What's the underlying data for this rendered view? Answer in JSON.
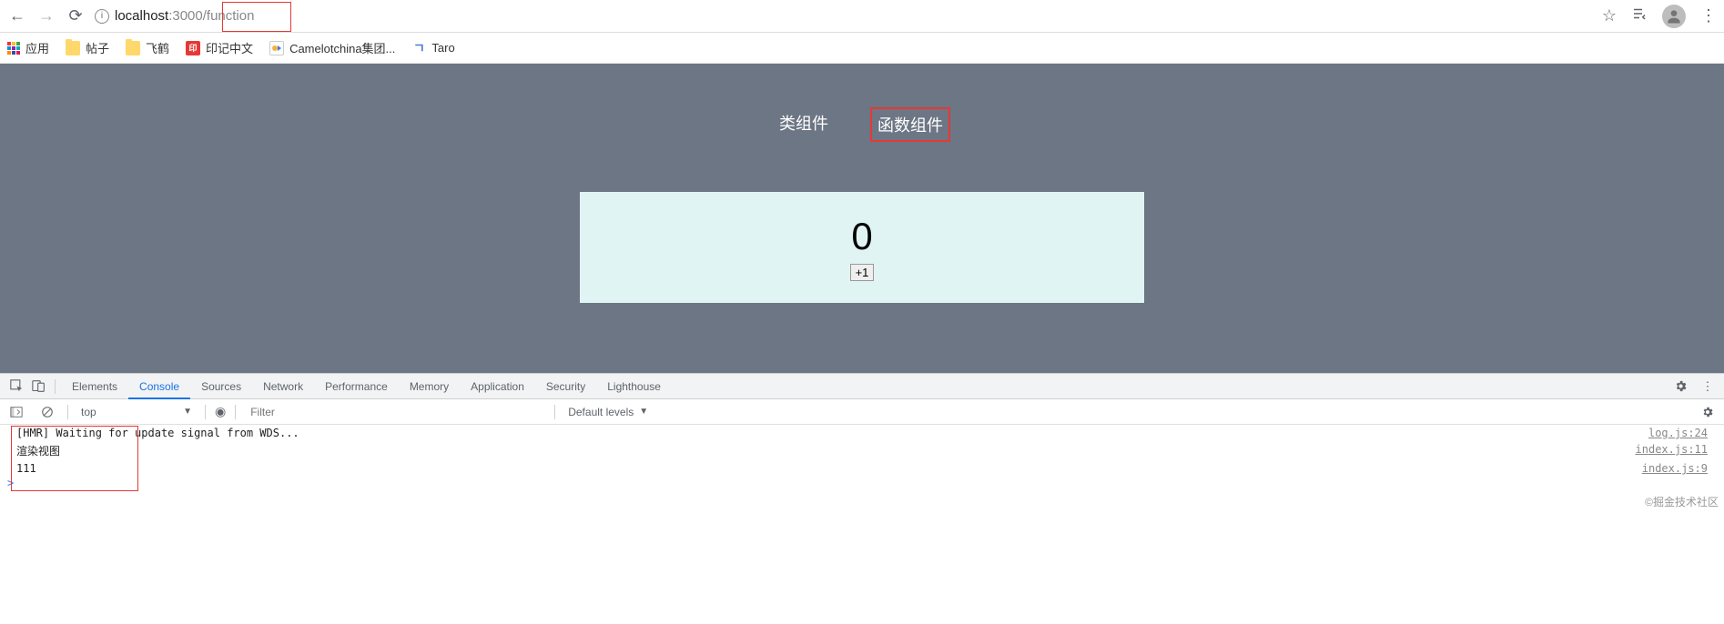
{
  "browser": {
    "url_host": "localhost",
    "url_port": ":3000",
    "url_path": "/function"
  },
  "bookmarks": [
    {
      "label": "应用",
      "icon": "apps"
    },
    {
      "label": "帖子",
      "icon": "folder"
    },
    {
      "label": "飞鹤",
      "icon": "folder"
    },
    {
      "label": "印记中文",
      "icon": "sq-red"
    },
    {
      "label": "Camelotchina集团...",
      "icon": "sq-white"
    },
    {
      "label": "Taro",
      "icon": "sq-blue"
    }
  ],
  "page": {
    "nav1": "类组件",
    "nav2": "函数组件",
    "counter_value": "0",
    "inc_button": "+1"
  },
  "devtools": {
    "tabs": [
      "Elements",
      "Console",
      "Sources",
      "Network",
      "Performance",
      "Memory",
      "Application",
      "Security",
      "Lighthouse"
    ],
    "active_tab": "Console",
    "context": "top",
    "filter_placeholder": "Filter",
    "levels": "Default levels",
    "logs": [
      {
        "msg": "[HMR] Waiting for update signal from WDS...",
        "src": "log.js:24"
      },
      {
        "msg": "渲染视图",
        "src": "index.js:11"
      },
      {
        "msg": "111",
        "src": "index.js:9"
      }
    ]
  },
  "watermark": "©掘金技术社区"
}
